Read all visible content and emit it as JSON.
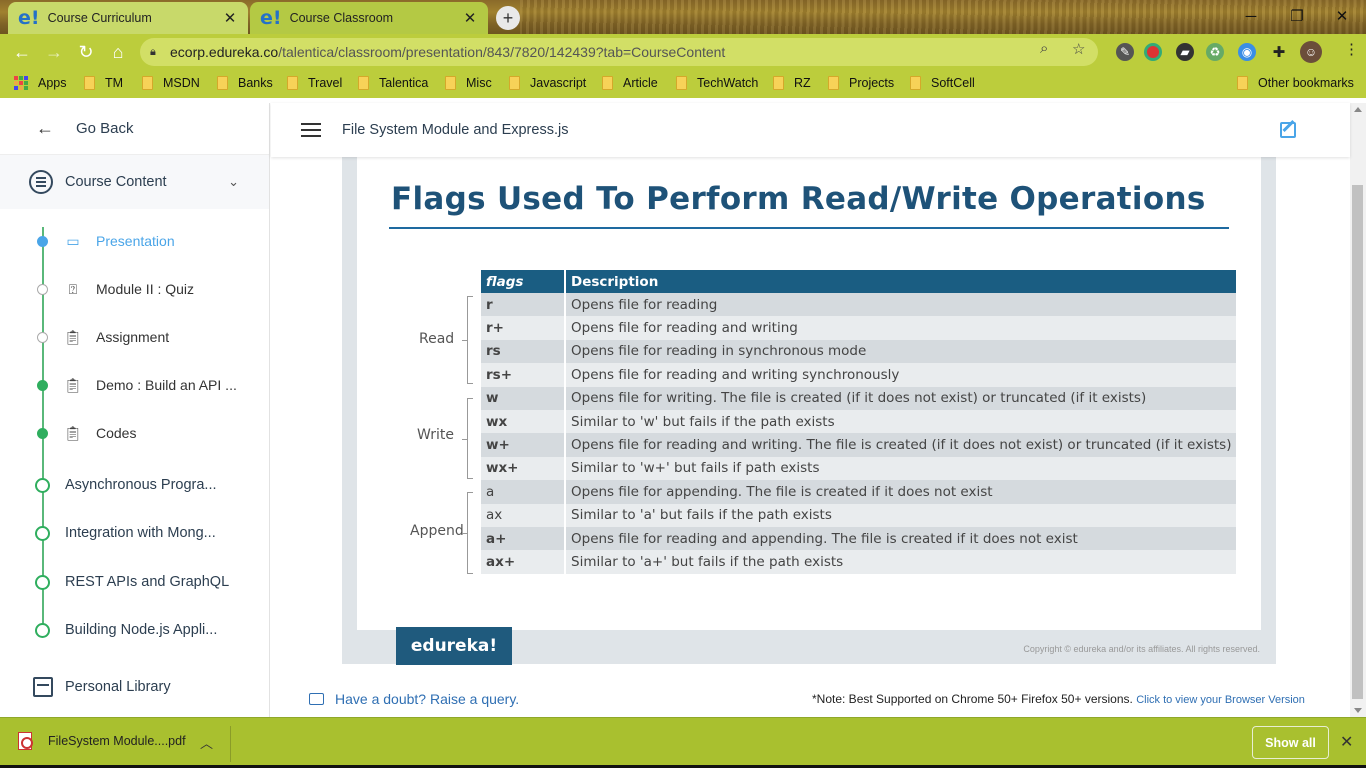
{
  "browser": {
    "tabs": [
      {
        "title": "Course Curriculum",
        "favicon": "e!",
        "active": true
      },
      {
        "title": "Course Classroom",
        "favicon": "e!",
        "active": false
      }
    ],
    "url_host": "ecorp.edureka.co",
    "url_path": "/talentica/classroom/presentation/843/7820/142439?tab=CourseContent",
    "bookmarks": [
      "Apps",
      "TM",
      "MSDN",
      "Banks",
      "Travel",
      "Talentica",
      "Misc",
      "Javascript",
      "Article",
      "TechWatch",
      "RZ",
      "Projects",
      "SoftCell"
    ],
    "other_bookmarks": "Other bookmarks",
    "chrome_color": "#bccd3c"
  },
  "sidebar": {
    "go_back": "Go Back",
    "course_content": "Course Content",
    "sub_items": [
      {
        "label": "Presentation",
        "state": "current",
        "icon": "presentation-icon"
      },
      {
        "label": "Module II : Quiz",
        "state": "pending",
        "icon": "quiz-icon"
      },
      {
        "label": "Assignment",
        "state": "pending",
        "icon": "clipboard-icon"
      },
      {
        "label": "Demo : Build an API ...",
        "state": "done",
        "icon": "clipboard-icon"
      },
      {
        "label": "Codes",
        "state": "done",
        "icon": "clipboard-icon"
      }
    ],
    "modules": [
      "Asynchronous Progra...",
      "Integration with Mong...",
      "REST APIs and GraphQL",
      "Building Node.js Appli..."
    ],
    "personal_library": "Personal Library"
  },
  "header": {
    "title": "File System Module and Express.js"
  },
  "slide": {
    "title": "Flags Used To Perform Read/Write Operations",
    "columns": [
      "flags",
      "Description"
    ],
    "groups": [
      "Read",
      "Write",
      "Append"
    ],
    "rows": [
      {
        "flag": "r",
        "desc": "Opens file for reading"
      },
      {
        "flag": "r+",
        "desc": "Opens file for reading and writing"
      },
      {
        "flag": "rs",
        "desc": "Opens file for reading in synchronous mode"
      },
      {
        "flag": "rs+",
        "desc": "Opens file for reading and writing synchronously"
      },
      {
        "flag": "w",
        "desc": "Opens file for writing. The file is created (if it does not exist) or truncated (if it exists)"
      },
      {
        "flag": "wx",
        "desc": "Similar to 'w' but fails if the path exists"
      },
      {
        "flag": "w+",
        "desc": "Opens file for reading and writing. The file is created (if it does not exist) or truncated (if it exists)"
      },
      {
        "flag": "wx+",
        "desc": "Similar to 'w+' but fails if path exists"
      },
      {
        "flag": "a",
        "desc": "Opens file for appending. The file is created if it does not exist"
      },
      {
        "flag": "ax",
        "desc": "Similar to  'a' but fails if the path exists"
      },
      {
        "flag": "a+",
        "desc": "Opens file for reading and appending. The file is created if it does not exist"
      },
      {
        "flag": "ax+",
        "desc": "Similar to  'a+' but fails if the path exists"
      }
    ],
    "logo": "edureka!",
    "copyright": "Copyright © edureka and/or its affiliates. All rights reserved."
  },
  "footer": {
    "doubt": "Have a doubt? Raise a query.",
    "note": "*Note: Best Supported on Chrome 50+ Firefox 50+ versions.",
    "browser_link": "Click to view your Browser Version"
  },
  "downloads": {
    "file": "FileSystem Module....pdf",
    "show_all": "Show all"
  }
}
